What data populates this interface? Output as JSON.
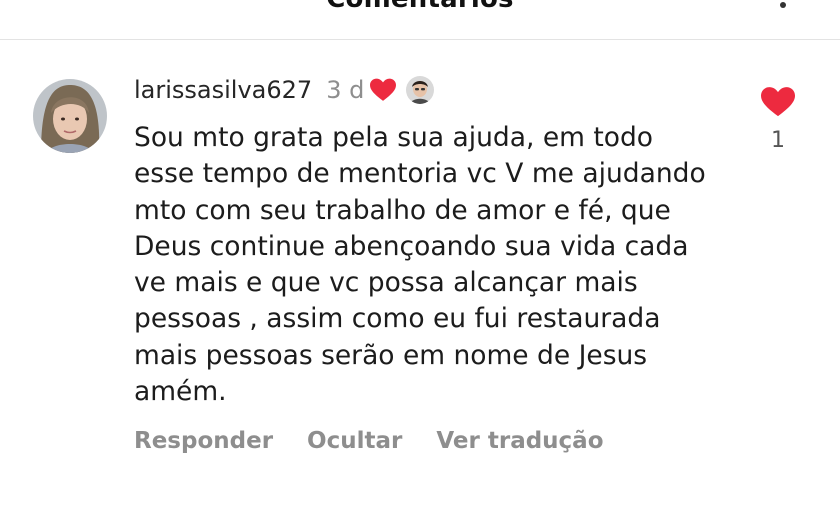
{
  "header": {
    "title": "Comentários"
  },
  "comment": {
    "username": "larissasilva627",
    "time": "3 d",
    "text": "Sou mto grata pela sua ajuda, em todo\nesse tempo de mentoria vc V me ajudando\nmto com seu trabalho de amor e fé,  que\nDeus continue abençoando sua vida cada\nve mais e que vc possa alcançar mais\npessoas , assim como eu fui restaurada\nmais pessoas serão em nome de Jesus\namém.",
    "actions": {
      "reply": "Responder",
      "hide": "Ocultar",
      "translate": "Ver tradução"
    },
    "like_count": "1"
  },
  "colors": {
    "heart": "#ed2a3f",
    "muted": "#8e8e8e"
  }
}
